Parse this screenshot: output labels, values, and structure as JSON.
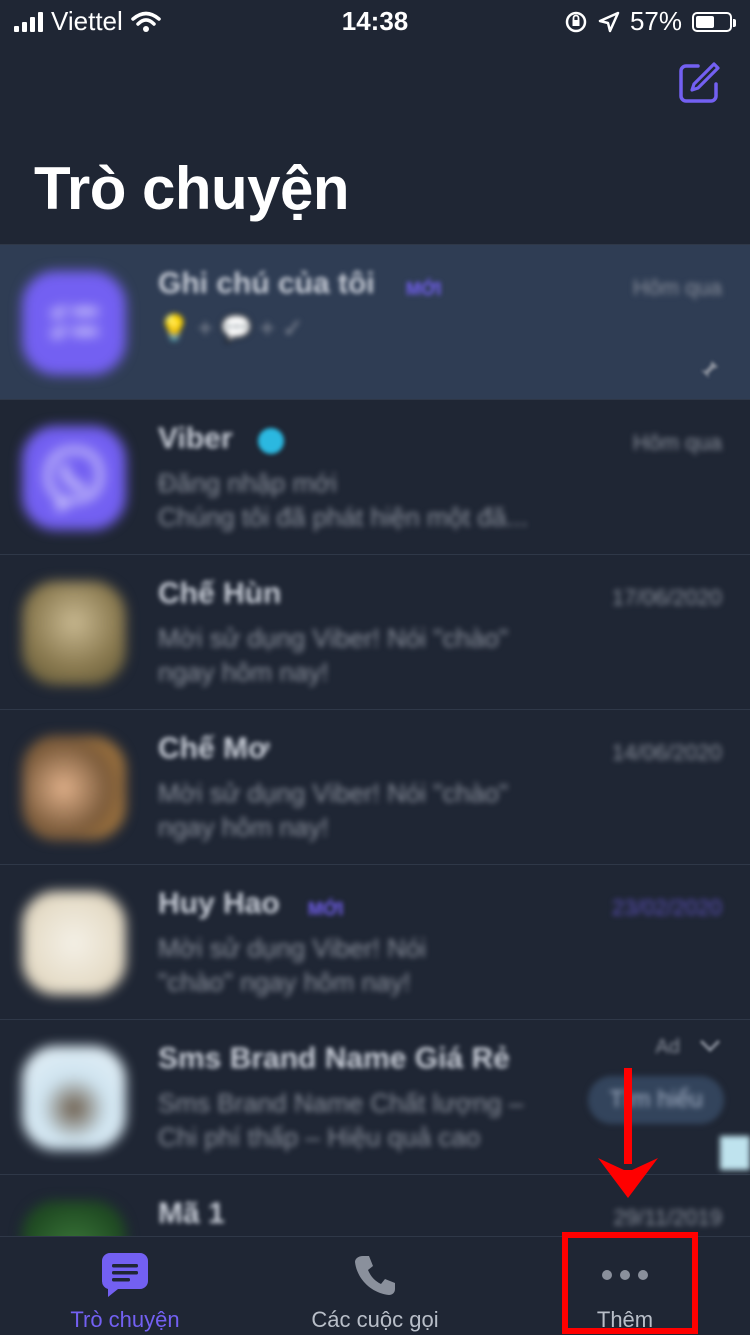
{
  "status_bar": {
    "carrier": "Viettel",
    "time": "14:38",
    "battery_percent": "57%",
    "battery_level": 0.57
  },
  "header": {
    "title": "Trò chuyện"
  },
  "chats": [
    {
      "name": "Ghi chú của tôi",
      "tag": "MỚI",
      "time": "Hôm qua",
      "preview": "💡 + 💬 + ✓",
      "pinned": true
    },
    {
      "name": "Viber",
      "time": "Hôm qua",
      "preview": "Đăng nhập mới\nChúng tôi đã phát hiện một đă...",
      "verified": true
    },
    {
      "name": "Chế Hùn",
      "time": "17/06/2020",
      "preview": "Mời sử dụng Viber! Nói \"chào\"\nngay hôm nay!"
    },
    {
      "name": "Chế Mơ",
      "time": "14/06/2020",
      "preview": "Mời sử dụng Viber! Nói \"chào\"\nngay hôm nay!"
    },
    {
      "name": "Huy Hao",
      "tag": "MỚI",
      "time": "23/02/2020",
      "preview": "Mời sử dụng Viber! Nói\n\"chào\" ngay hôm nay!"
    },
    {
      "name": "Sms Brand Name Giá Rẻ",
      "ad_label": "Ad",
      "button": "Tìm hiểu",
      "preview": "Sms Brand Name Chất lượng –\nChi phí thấp – Hiệu quả cao"
    },
    {
      "name": "Mã 1",
      "time": "29/11/2019",
      "preview": ""
    }
  ],
  "tabs": [
    {
      "label": "Trò chuyện",
      "icon": "chat-bubble-icon",
      "active": true
    },
    {
      "label": "Các cuộc gọi",
      "icon": "phone-icon"
    },
    {
      "label": "Thêm",
      "icon": "more-dots-icon"
    }
  ],
  "colors": {
    "background": "#1f2634",
    "accent": "#7360f2",
    "pinned_row": "#2f3d54",
    "annotation": "#ff0000"
  }
}
